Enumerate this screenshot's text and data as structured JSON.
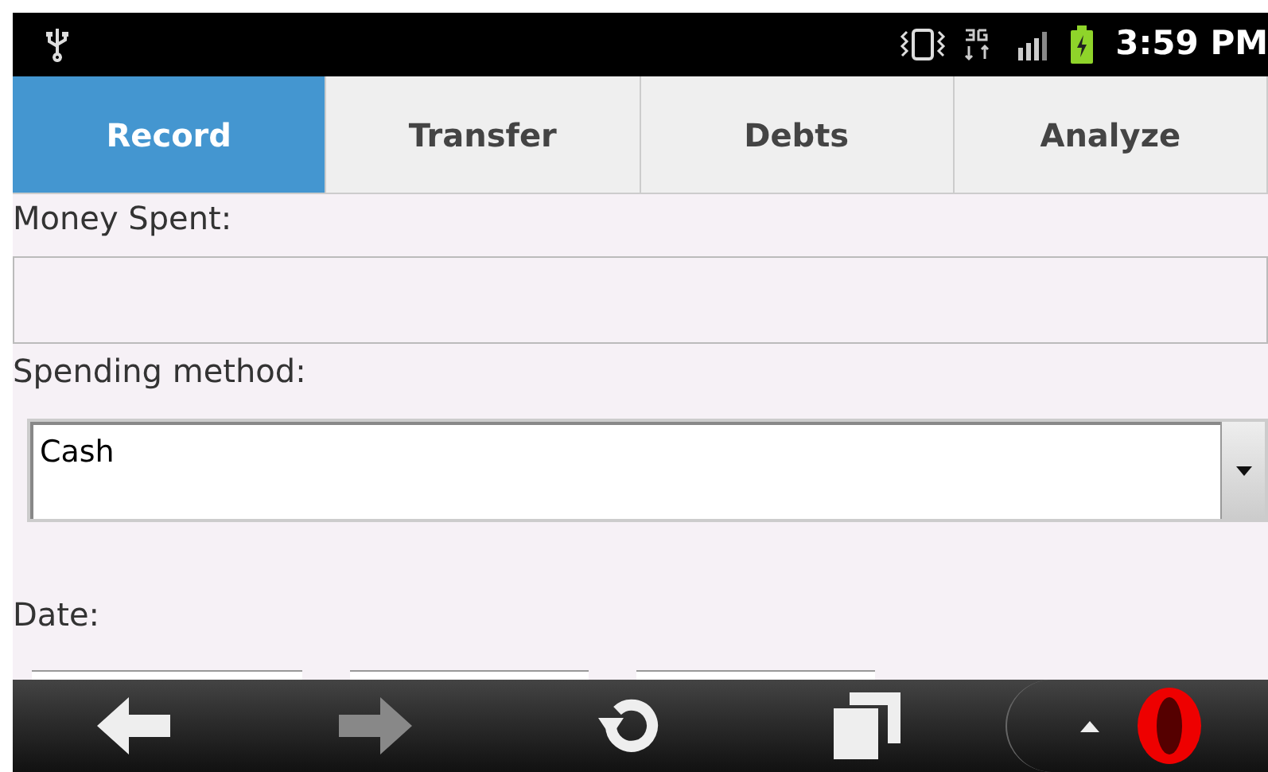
{
  "status_bar": {
    "time": "3:59 PM"
  },
  "tabs": [
    {
      "label": "Record",
      "selected": true
    },
    {
      "label": "Transfer",
      "selected": false
    },
    {
      "label": "Debts",
      "selected": false
    },
    {
      "label": "Analyze",
      "selected": false
    }
  ],
  "money_spent": {
    "label": "Money Spent:"
  },
  "spending_method": {
    "label": "Spending method:",
    "value": "Cash"
  },
  "date": {
    "label": "Date:"
  }
}
